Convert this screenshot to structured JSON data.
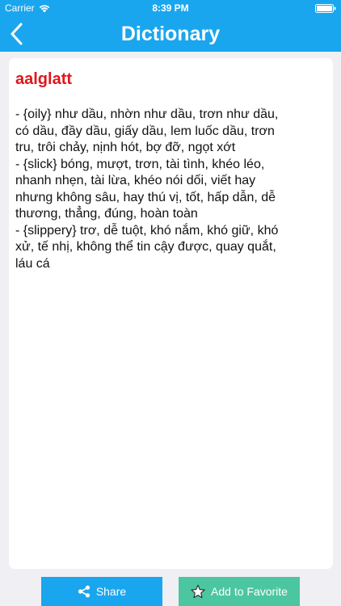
{
  "status_bar": {
    "carrier": "Carrier",
    "time": "8:39 PM",
    "icons": [
      "wifi-icon",
      "battery-icon"
    ]
  },
  "nav_bar": {
    "back_icon": "chevron-left-icon",
    "title": "Dictionary"
  },
  "entry": {
    "word": "aalglatt",
    "definition_lines": [
      "- {oily} như dầu, nhờn như dầu, trơn như dầu,",
      "có dầu, đầy dầu, giấy dầu, lem luốc dầu, trơn",
      "tru, trôi chảy, nịnh hót, bợ đỡ, ngọt xớt",
      "- {slick} bóng, mượt, trơn, tài tình, khéo léo,",
      "nhanh nhẹn, tài lừa, khéo nói dối, viết hay",
      "nhưng không sâu, hay thú vị, tốt, hấp dẫn, dễ",
      "thương, thẳng, đúng, hoàn toàn",
      "- {slippery} trơ, dễ tuột, khó nắm, khó giữ, khó",
      "xử, tế nhị, không thể tin cậy được, quay quắt,",
      "láu cá"
    ]
  },
  "bottom_bar": {
    "share_label": "Share",
    "share_icon": "share-icon",
    "favorite_label": "Add to Favorite",
    "favorite_icon": "star-icon"
  },
  "colors": {
    "accent": "#1aa6ee",
    "word": "#e0161b",
    "favorite": "#4cc6a0",
    "background": "#efeff4"
  }
}
